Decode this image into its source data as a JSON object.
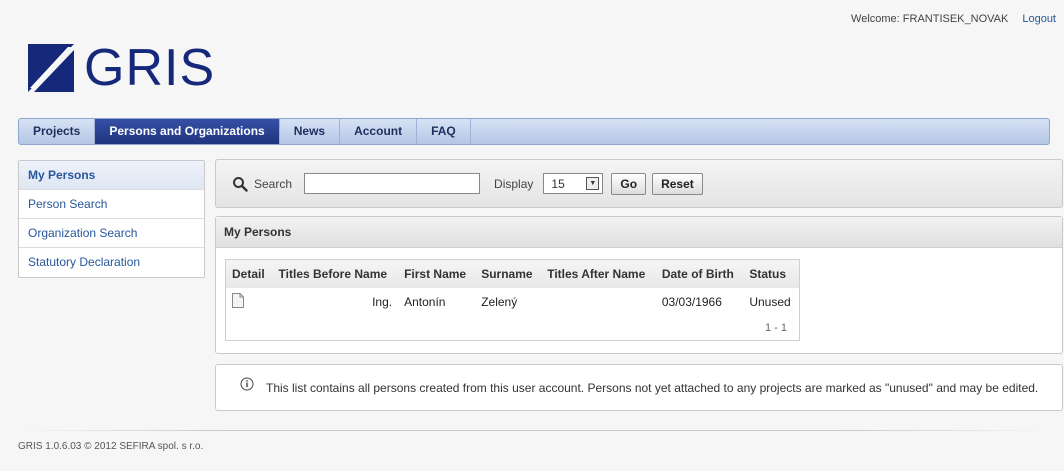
{
  "topbar": {
    "welcome": "Welcome: FRANTISEK_NOVAK",
    "logout": "Logout"
  },
  "logo": {
    "text": "GRIS",
    "color": "#16287a"
  },
  "nav": {
    "tabs": [
      {
        "label": "Projects",
        "active": false
      },
      {
        "label": "Persons and Organizations",
        "active": true
      },
      {
        "label": "News",
        "active": false
      },
      {
        "label": "Account",
        "active": false
      },
      {
        "label": "FAQ",
        "active": false
      }
    ]
  },
  "sidebar": {
    "items": [
      {
        "label": "My Persons",
        "active": true
      },
      {
        "label": "Person Search",
        "active": false
      },
      {
        "label": "Organization Search",
        "active": false
      },
      {
        "label": "Statutory Declaration",
        "active": false
      }
    ]
  },
  "search": {
    "label": "Search",
    "value": "",
    "display_label": "Display",
    "display_value": "15",
    "go_label": "Go",
    "reset_label": "Reset"
  },
  "region": {
    "title": "My Persons",
    "columns": [
      "Detail",
      "Titles Before Name",
      "First Name",
      "Surname",
      "Titles After Name",
      "Date of Birth",
      "Status"
    ],
    "rows": [
      {
        "titles_before": "Ing.",
        "first_name": "Antonín",
        "surname": "Zelený",
        "titles_after": "",
        "dob": "03/03/1966",
        "status": "Unused"
      }
    ],
    "pagination": "1 - 1"
  },
  "info": {
    "text": "This list contains all persons created from this user account. Persons not yet attached to any projects are marked as \"unused\" and may be edited."
  },
  "footer": {
    "text": "GRIS 1.0.6.03 © 2012 SEFIRA spol. s r.o."
  }
}
